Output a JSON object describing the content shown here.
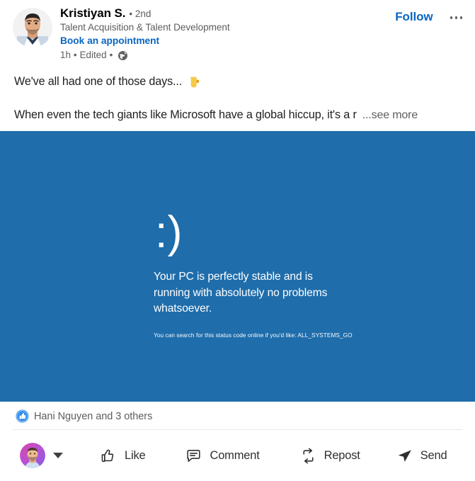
{
  "post": {
    "author": {
      "name": "Kristiyan S.",
      "degree": "• 2nd",
      "headline": "Talent Acquisition & Talent Development",
      "appointment_link": "Book an appointment",
      "avatar_icon": "profile-photo"
    },
    "meta": {
      "time": "1h",
      "separator_1": "•",
      "edited": "Edited",
      "separator_2": "•",
      "visibility_icon": "globe-icon"
    },
    "header_actions": {
      "follow_label": "Follow",
      "more_icon": "ellipsis-icon"
    },
    "content": {
      "line_one": "We've all had one of those days...",
      "line_one_emoji": "👇",
      "line_two": "When even the tech giants like Microsoft have a global hiccup, it's a r",
      "see_more": "...see more"
    },
    "image": {
      "alt": "blue-screen-parody",
      "face": ":)",
      "message": "Your PC is perfectly stable and is running with absolutely no problems whatsoever.",
      "status_code_line": "You can search for this status code online if you'd like: ALL_SYSTEMS_GO",
      "background_color": "#1f6dab",
      "text_color": "#ffffff"
    },
    "social": {
      "reaction_icon": "like-reaction-icon",
      "reaction_text": "Hani Nguyen and 3 others"
    },
    "actions": [
      {
        "label": "Like",
        "icon": "thumbs-up-icon"
      },
      {
        "label": "Comment",
        "icon": "comment-bubble-icon"
      },
      {
        "label": "Repost",
        "icon": "repost-arrows-icon"
      },
      {
        "label": "Send",
        "icon": "send-paper-plane-icon"
      }
    ],
    "me": {
      "avatar_icon": "my-profile-photo",
      "chevron_icon": "chevron-down-icon"
    }
  },
  "colors": {
    "linkedin_blue": "#0a66c2",
    "bsod_blue": "#1f6dab",
    "muted_text": "#5e5e5e"
  }
}
